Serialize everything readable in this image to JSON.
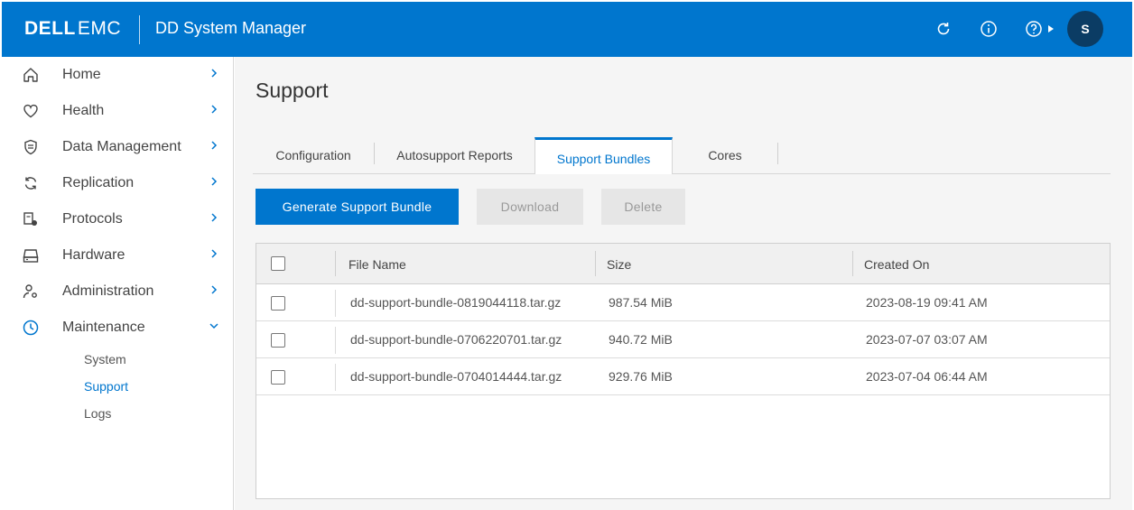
{
  "header": {
    "brand_dell": "DELL",
    "brand_emc": "EMC",
    "app_title": "DD System Manager",
    "avatar_initial": "S",
    "accent_color": "#0076ce"
  },
  "sidebar": {
    "items": [
      {
        "label": "Home",
        "icon": "home-icon"
      },
      {
        "label": "Health",
        "icon": "heart-icon"
      },
      {
        "label": "Data Management",
        "icon": "shield-icon"
      },
      {
        "label": "Replication",
        "icon": "sync-icon"
      },
      {
        "label": "Protocols",
        "icon": "protocol-icon"
      },
      {
        "label": "Hardware",
        "icon": "drive-icon"
      },
      {
        "label": "Administration",
        "icon": "user-gear-icon"
      },
      {
        "label": "Maintenance",
        "icon": "clock-icon"
      }
    ],
    "maintenance_sub": [
      "System",
      "Support",
      "Logs"
    ],
    "active_sub": "Support"
  },
  "main": {
    "page_title": "Support",
    "tabs": [
      "Configuration",
      "Autosupport Reports",
      "Support Bundles",
      "Cores"
    ],
    "active_tab": "Support Bundles",
    "buttons": {
      "generate": "Generate Support Bundle",
      "download": "Download",
      "delete": "Delete"
    },
    "table": {
      "columns": [
        "File Name",
        "Size",
        "Created On"
      ],
      "rows": [
        {
          "file": "dd-support-bundle-0819044118.tar.gz",
          "size": "987.54 MiB",
          "created": "2023-08-19 09:41 AM"
        },
        {
          "file": "dd-support-bundle-0706220701.tar.gz",
          "size": "940.72 MiB",
          "created": "2023-07-07 03:07 AM"
        },
        {
          "file": "dd-support-bundle-0704014444.tar.gz",
          "size": "929.76 MiB",
          "created": "2023-07-04 06:44 AM"
        }
      ]
    }
  }
}
